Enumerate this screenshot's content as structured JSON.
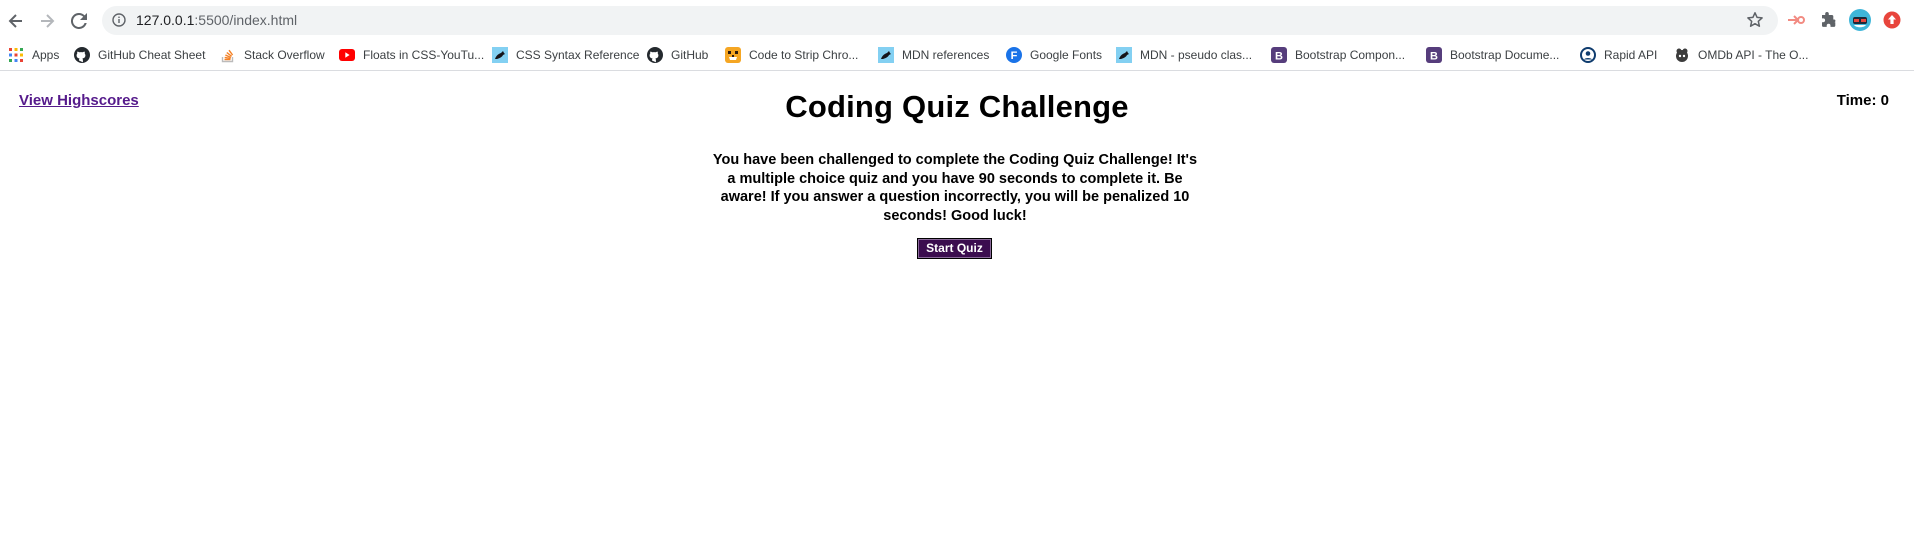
{
  "browser": {
    "url_host": "127.0.0.1",
    "url_path": ":5500/index.html",
    "bookmarks": [
      {
        "label": "Apps",
        "icon": "apps-grid-icon"
      },
      {
        "label": "GitHub Cheat Sheet",
        "icon": "github-icon"
      },
      {
        "label": "Stack Overflow",
        "icon": "stack-overflow-icon"
      },
      {
        "label": "Floats in CSS-YouTu...",
        "icon": "youtube-icon"
      },
      {
        "label": "CSS Syntax Reference",
        "icon": "mdn-icon"
      },
      {
        "label": "GitHub",
        "icon": "github-icon"
      },
      {
        "label": "Code to Strip Chro...",
        "icon": "tiger-icon"
      },
      {
        "label": "MDN references",
        "icon": "mdn-icon"
      },
      {
        "label": "Google Fonts",
        "icon": "google-fonts-icon"
      },
      {
        "label": "MDN - pseudo clas...",
        "icon": "mdn-icon"
      },
      {
        "label": "Bootstrap Compon...",
        "icon": "bootstrap-icon"
      },
      {
        "label": "Bootstrap Docume...",
        "icon": "bootstrap-icon"
      },
      {
        "label": "Rapid API",
        "icon": "rapid-api-icon"
      },
      {
        "label": "OMDb API - The O...",
        "icon": "omdb-icon"
      }
    ],
    "colors": {
      "youtube": "#ff0000",
      "bootstrap": "#563d7c",
      "google_fonts": "#1a73e8",
      "mdn": "#83d0f2"
    }
  },
  "page": {
    "highscores_link": "View Highscores",
    "timer_label": "Time: ",
    "timer_value": "0",
    "title": "Coding Quiz Challenge",
    "intro": "You have been challenged to complete the Coding Quiz Challenge! It's a multiple choice quiz and you have 90 seconds to complete it. Be aware! If you answer a question incorrectly, you will be penalized 10 seconds! Good luck!",
    "start_button": "Start Quiz",
    "colors": {
      "link": "#551a8b",
      "button_bg": "#3b0d4f",
      "button_text": "#ffffff"
    }
  }
}
